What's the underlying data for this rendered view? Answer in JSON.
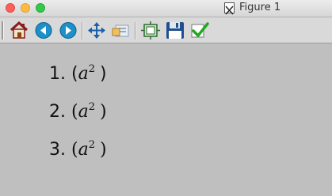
{
  "window": {
    "title": "Figure 1"
  },
  "toolbar": {
    "buttons": [
      {
        "name": "home",
        "icon": "home-icon"
      },
      {
        "name": "back",
        "icon": "back-arrow-icon"
      },
      {
        "name": "forward",
        "icon": "forward-arrow-icon"
      },
      {
        "name": "pan",
        "icon": "move-arrows-icon"
      },
      {
        "name": "zoom",
        "icon": "zoom-rect-icon"
      },
      {
        "name": "subplots",
        "icon": "configure-subplots-icon"
      },
      {
        "name": "save",
        "icon": "floppy-disk-icon"
      },
      {
        "name": "edit",
        "icon": "checkmark-icon"
      }
    ]
  },
  "items": [
    {
      "number": "1.",
      "open": "(",
      "base": "a",
      "exp": "2",
      "close": ")"
    },
    {
      "number": "2.",
      "open": "(",
      "base": "a",
      "exp": "2",
      "close": ")"
    },
    {
      "number": "3.",
      "open": "(",
      "base": "a",
      "exp": "2",
      "close": ")"
    }
  ]
}
